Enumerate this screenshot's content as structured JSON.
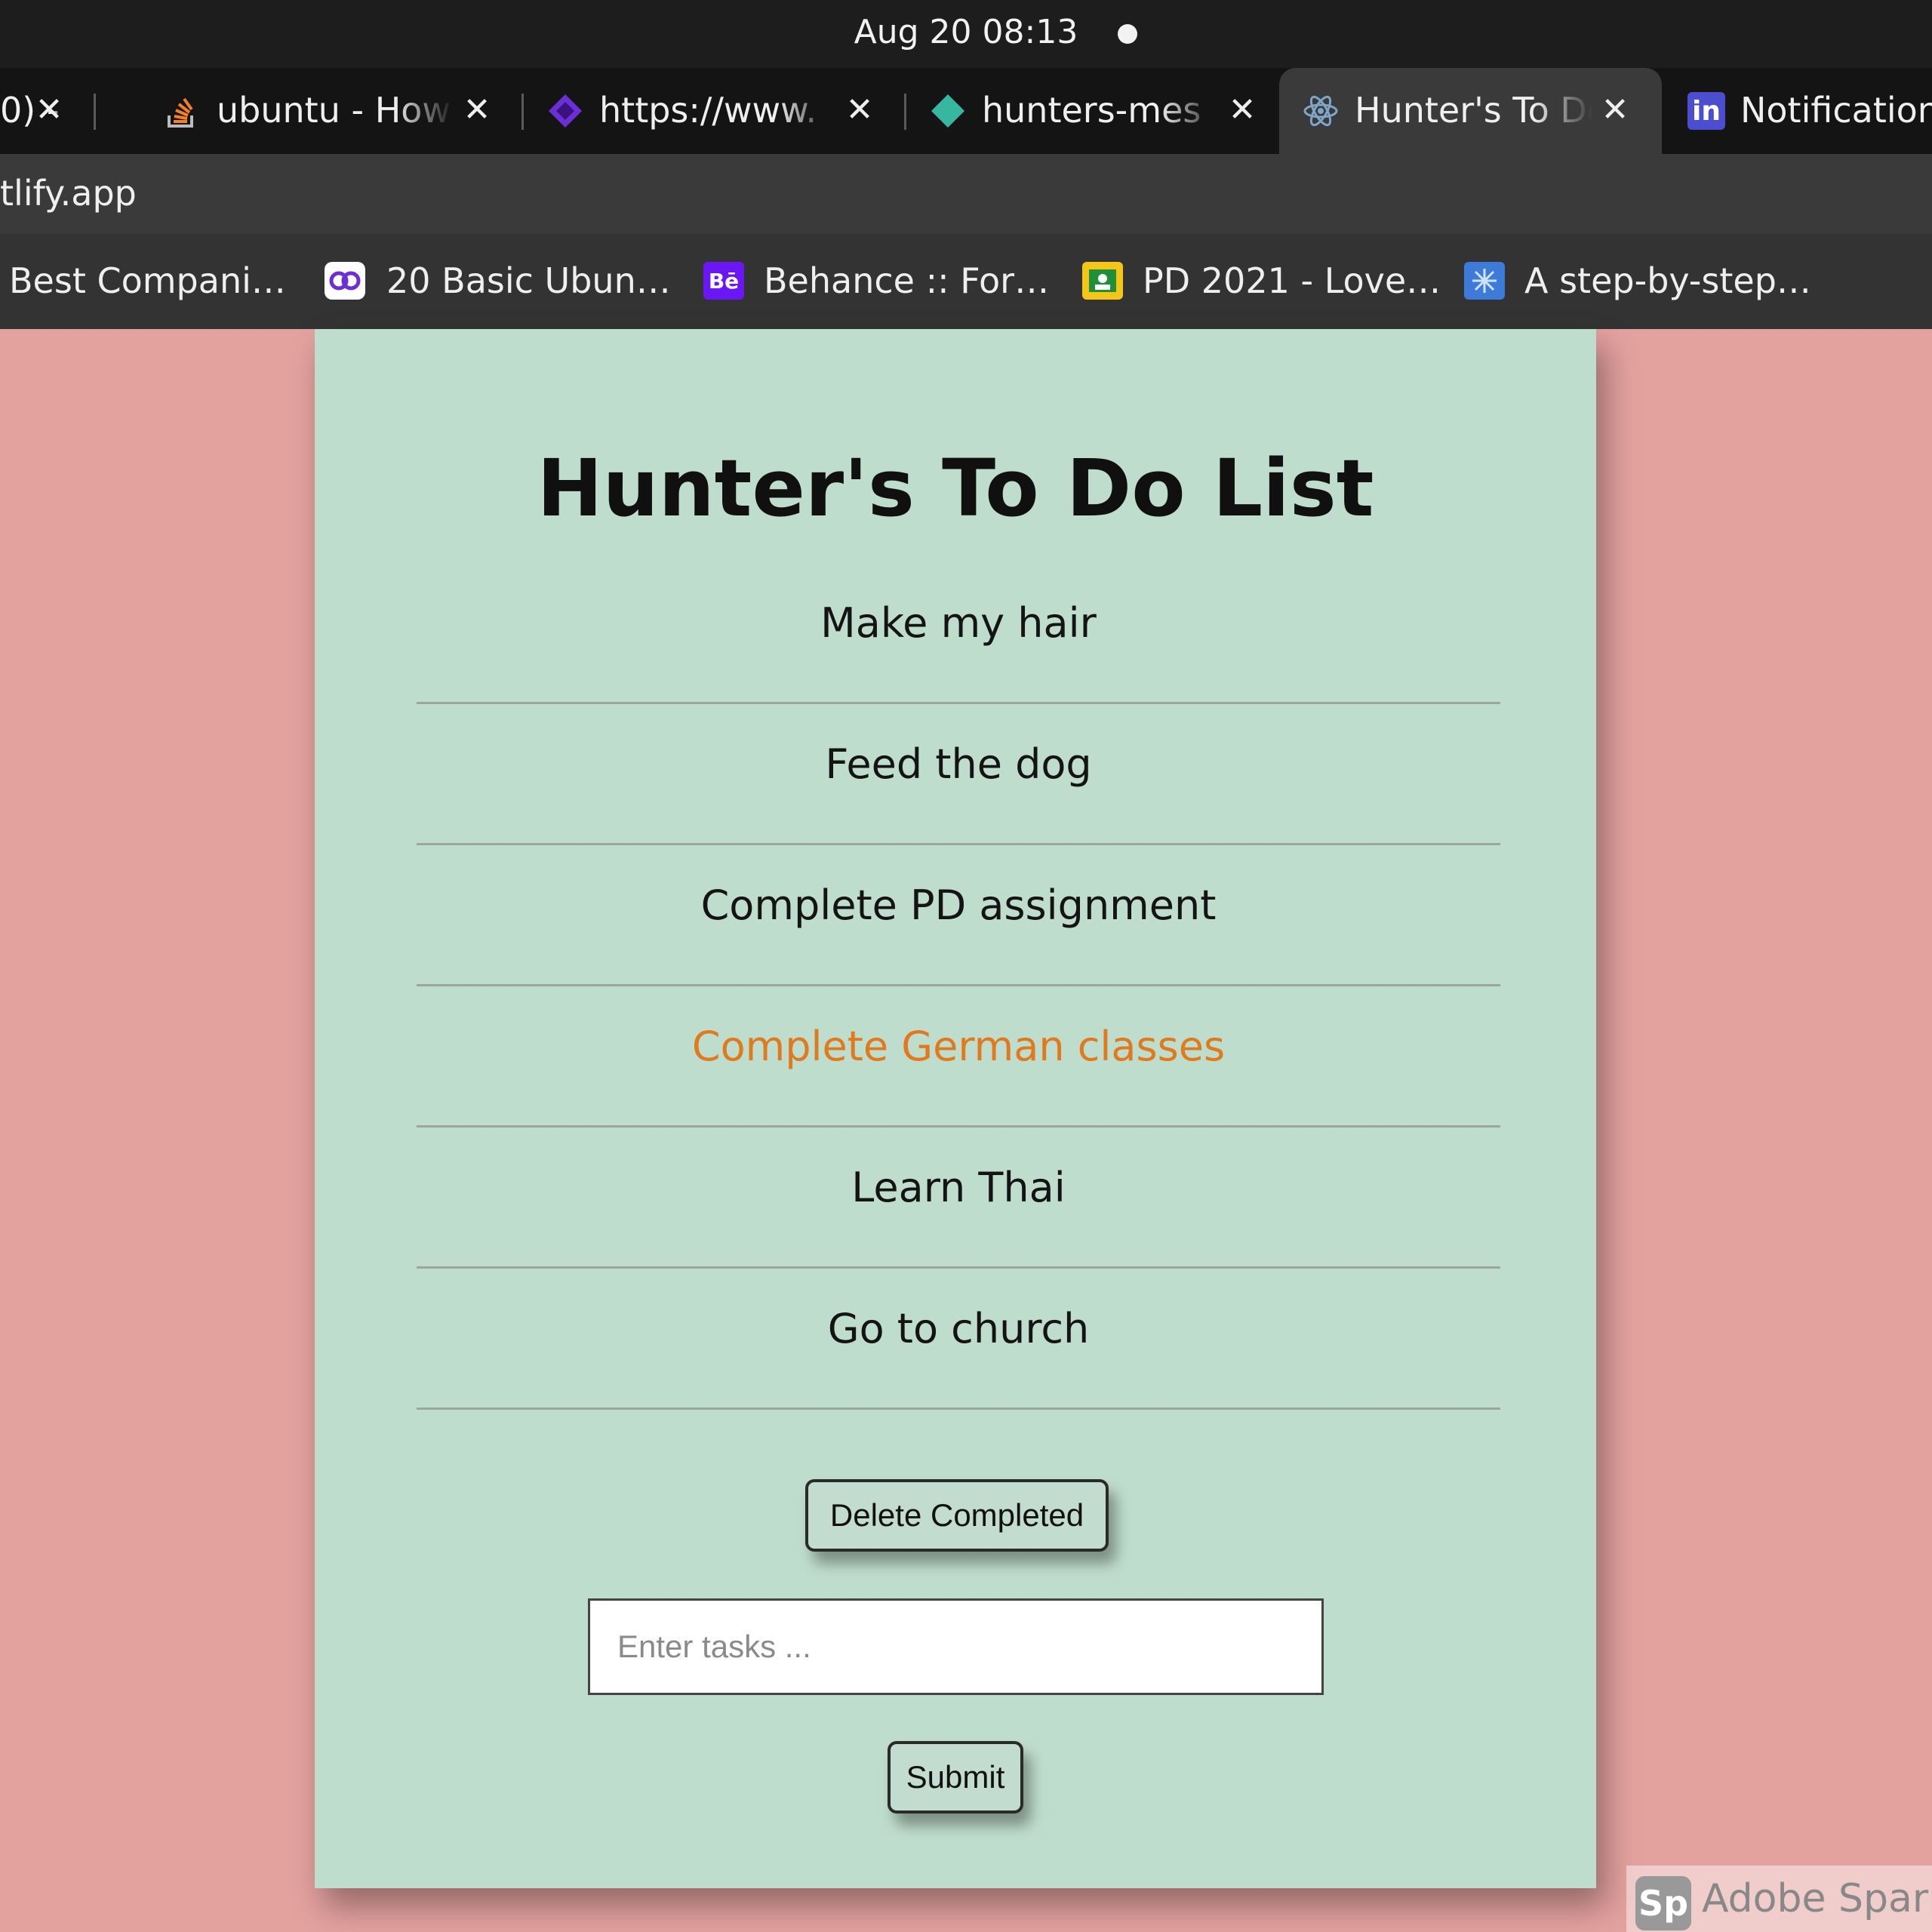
{
  "system": {
    "clock": "Aug 20  08:13"
  },
  "tabs": [
    {
      "title": "0) -",
      "favicon": "unknown-icon"
    },
    {
      "title": "ubuntu - How",
      "favicon": "stackoverflow-icon"
    },
    {
      "title": "https://www.",
      "favicon": "purple-diamond-icon"
    },
    {
      "title": "hunters-mes",
      "favicon": "netlify-icon"
    },
    {
      "title": "Hunter's To Do",
      "favicon": "react-icon",
      "active": true
    },
    {
      "title": "Notifications",
      "favicon": "linkedin-icon"
    }
  ],
  "address_bar": {
    "url": "tlify.app"
  },
  "bookmarks": [
    {
      "label": "Best Compani…",
      "icon": ""
    },
    {
      "label": "20 Basic Ubun…",
      "icon": "link-icon"
    },
    {
      "label": "Behance :: For…",
      "icon": "behance-icon",
      "icon_text": "Bē"
    },
    {
      "label": "PD 2021 - Love…",
      "icon": "classroom-icon"
    },
    {
      "label": "A step-by-step…",
      "icon": "sparkle-icon"
    }
  ],
  "app": {
    "title": "Hunter's To Do List",
    "tasks": [
      {
        "text": "Make my hair",
        "completed": false
      },
      {
        "text": "Feed the dog",
        "completed": false
      },
      {
        "text": "Complete PD assignment",
        "completed": false
      },
      {
        "text": "Complete German classes",
        "completed": true
      },
      {
        "text": "Learn Thai",
        "completed": false
      },
      {
        "text": "Go to church",
        "completed": false
      }
    ],
    "delete_label": "Delete Completed",
    "input": {
      "value": "",
      "placeholder": "Enter tasks ..."
    },
    "submit_label": "Submit",
    "completed_color": "#e07a1e"
  },
  "watermark": {
    "logo": "Sp",
    "text": "Adobe Spark"
  },
  "colors": {
    "page_bg": "#e4a29f",
    "card_bg": "#bfddcd",
    "top_bar": "#1d1d1d"
  }
}
